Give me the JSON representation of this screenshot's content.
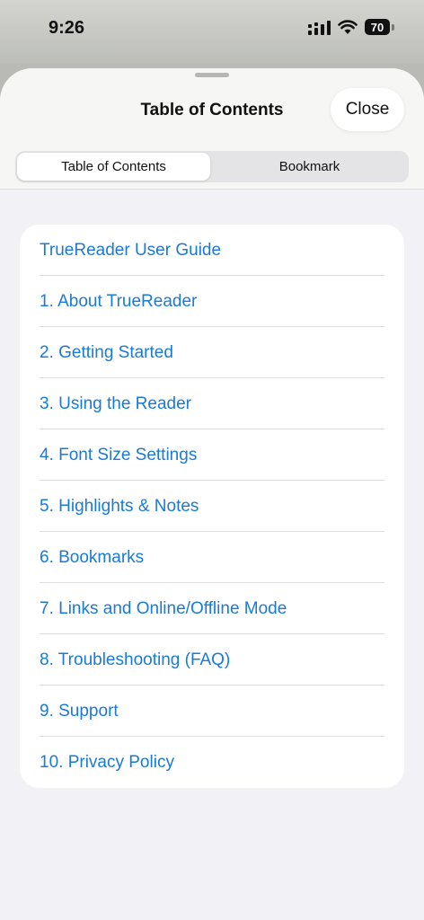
{
  "status_bar": {
    "time": "9:26",
    "battery": "70",
    "icons": [
      "signal-icon",
      "wifi-icon",
      "battery-icon"
    ]
  },
  "sheet": {
    "title": "Table of Contents",
    "close_label": "Close"
  },
  "segments": {
    "items": [
      {
        "label": "Table of Contents",
        "selected": true
      },
      {
        "label": "Bookmark",
        "selected": false
      }
    ]
  },
  "toc": {
    "link_color": "#1a7ad8",
    "items": [
      {
        "label": "TrueReader User Guide"
      },
      {
        "label": "1. About TrueReader"
      },
      {
        "label": "2. Getting Started"
      },
      {
        "label": "3. Using the Reader"
      },
      {
        "label": "4. Font Size Settings"
      },
      {
        "label": "5. Highlights & Notes"
      },
      {
        "label": "6. Bookmarks"
      },
      {
        "label": "7. Links and Online/Offline Mode"
      },
      {
        "label": "8. Troubleshooting (FAQ)"
      },
      {
        "label": "9. Support"
      },
      {
        "label": "10. Privacy Policy"
      }
    ]
  }
}
